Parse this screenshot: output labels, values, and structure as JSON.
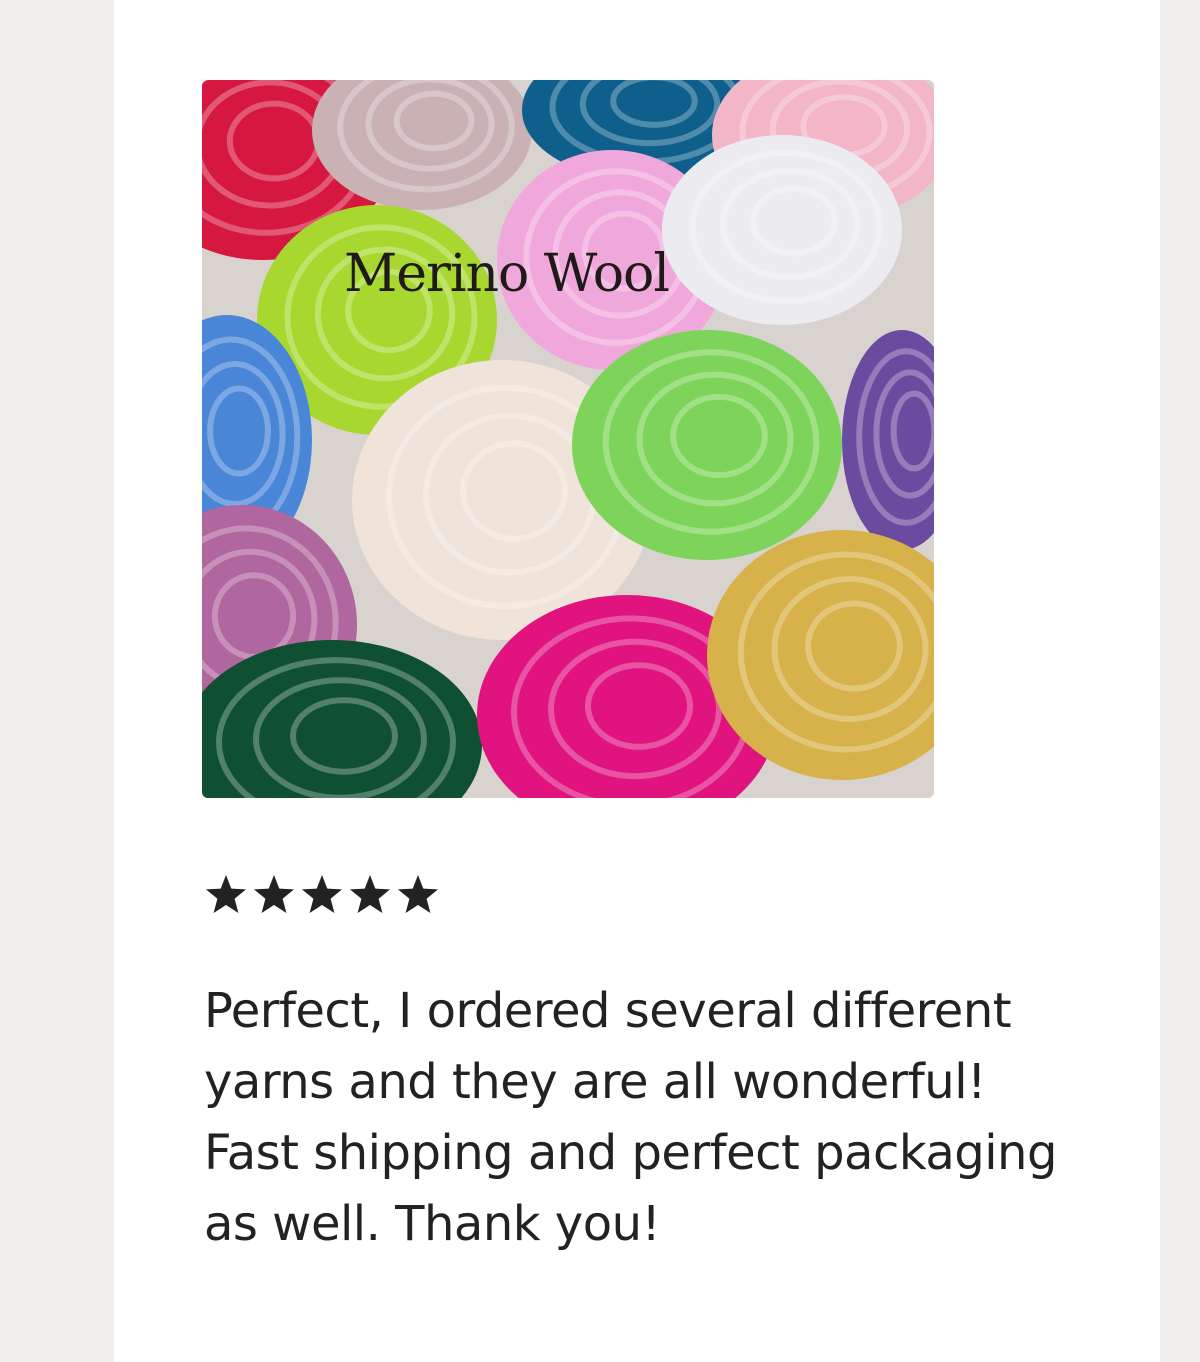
{
  "product_image": {
    "caption": "Merino Wool",
    "rovings": [
      {
        "color": "#d6173f"
      },
      {
        "color": "#c9b1b4"
      },
      {
        "color": "#0f5f8c"
      },
      {
        "color": "#f2b6c6"
      },
      {
        "color": "#a8d830"
      },
      {
        "color": "#f0a8dc"
      },
      {
        "color": "#ecebf0"
      },
      {
        "color": "#4a86d8"
      },
      {
        "color": "#efe3da"
      },
      {
        "color": "#7ed45a"
      },
      {
        "color": "#6b4ba0"
      },
      {
        "color": "#b0669e"
      },
      {
        "color": "#0f4f32"
      },
      {
        "color": "#e0137f"
      },
      {
        "color": "#d7b14a"
      }
    ]
  },
  "review": {
    "rating": 5,
    "rating_max": 5,
    "star_color": "#222222",
    "text": "Perfect, I ordered several different yarns and they are all wonderful! Fast shipping and perfect packaging as well. Thank you!"
  }
}
